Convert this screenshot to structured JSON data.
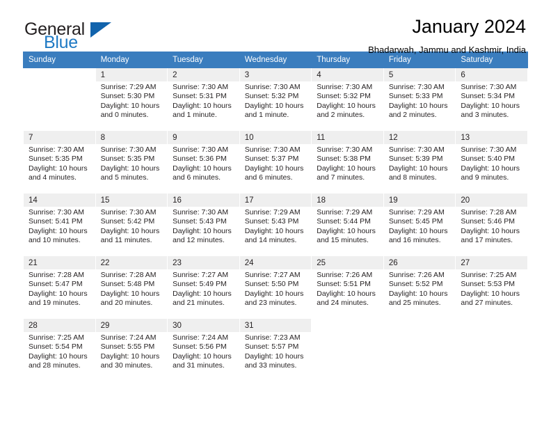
{
  "brand": {
    "word_one": "General",
    "word_two": "Blue",
    "triangle_icon": "triangle-logo-icon",
    "accent_color": "#1163ac",
    "blue_text_color": "#1f7ac4"
  },
  "header": {
    "title": "January 2024",
    "subtitle": "Bhadarwah, Jammu and Kashmir, India"
  },
  "colors": {
    "header_row_bg": "#3a7dbe",
    "header_row_text": "#ffffff",
    "daynum_bg": "#efefef",
    "body_text": "#231f20"
  },
  "weekday_headers": [
    "Sunday",
    "Monday",
    "Tuesday",
    "Wednesday",
    "Thursday",
    "Friday",
    "Saturday"
  ],
  "weeks": [
    [
      {
        "day": "",
        "lines": []
      },
      {
        "day": "1",
        "lines": [
          "Sunrise: 7:29 AM",
          "Sunset: 5:30 PM",
          "Daylight: 10 hours",
          "and 0 minutes."
        ]
      },
      {
        "day": "2",
        "lines": [
          "Sunrise: 7:30 AM",
          "Sunset: 5:31 PM",
          "Daylight: 10 hours",
          "and 1 minute."
        ]
      },
      {
        "day": "3",
        "lines": [
          "Sunrise: 7:30 AM",
          "Sunset: 5:32 PM",
          "Daylight: 10 hours",
          "and 1 minute."
        ]
      },
      {
        "day": "4",
        "lines": [
          "Sunrise: 7:30 AM",
          "Sunset: 5:32 PM",
          "Daylight: 10 hours",
          "and 2 minutes."
        ]
      },
      {
        "day": "5",
        "lines": [
          "Sunrise: 7:30 AM",
          "Sunset: 5:33 PM",
          "Daylight: 10 hours",
          "and 2 minutes."
        ]
      },
      {
        "day": "6",
        "lines": [
          "Sunrise: 7:30 AM",
          "Sunset: 5:34 PM",
          "Daylight: 10 hours",
          "and 3 minutes."
        ]
      }
    ],
    [
      {
        "day": "7",
        "lines": [
          "Sunrise: 7:30 AM",
          "Sunset: 5:35 PM",
          "Daylight: 10 hours",
          "and 4 minutes."
        ]
      },
      {
        "day": "8",
        "lines": [
          "Sunrise: 7:30 AM",
          "Sunset: 5:35 PM",
          "Daylight: 10 hours",
          "and 5 minutes."
        ]
      },
      {
        "day": "9",
        "lines": [
          "Sunrise: 7:30 AM",
          "Sunset: 5:36 PM",
          "Daylight: 10 hours",
          "and 6 minutes."
        ]
      },
      {
        "day": "10",
        "lines": [
          "Sunrise: 7:30 AM",
          "Sunset: 5:37 PM",
          "Daylight: 10 hours",
          "and 6 minutes."
        ]
      },
      {
        "day": "11",
        "lines": [
          "Sunrise: 7:30 AM",
          "Sunset: 5:38 PM",
          "Daylight: 10 hours",
          "and 7 minutes."
        ]
      },
      {
        "day": "12",
        "lines": [
          "Sunrise: 7:30 AM",
          "Sunset: 5:39 PM",
          "Daylight: 10 hours",
          "and 8 minutes."
        ]
      },
      {
        "day": "13",
        "lines": [
          "Sunrise: 7:30 AM",
          "Sunset: 5:40 PM",
          "Daylight: 10 hours",
          "and 9 minutes."
        ]
      }
    ],
    [
      {
        "day": "14",
        "lines": [
          "Sunrise: 7:30 AM",
          "Sunset: 5:41 PM",
          "Daylight: 10 hours",
          "and 10 minutes."
        ]
      },
      {
        "day": "15",
        "lines": [
          "Sunrise: 7:30 AM",
          "Sunset: 5:42 PM",
          "Daylight: 10 hours",
          "and 11 minutes."
        ]
      },
      {
        "day": "16",
        "lines": [
          "Sunrise: 7:30 AM",
          "Sunset: 5:43 PM",
          "Daylight: 10 hours",
          "and 12 minutes."
        ]
      },
      {
        "day": "17",
        "lines": [
          "Sunrise: 7:29 AM",
          "Sunset: 5:43 PM",
          "Daylight: 10 hours",
          "and 14 minutes."
        ]
      },
      {
        "day": "18",
        "lines": [
          "Sunrise: 7:29 AM",
          "Sunset: 5:44 PM",
          "Daylight: 10 hours",
          "and 15 minutes."
        ]
      },
      {
        "day": "19",
        "lines": [
          "Sunrise: 7:29 AM",
          "Sunset: 5:45 PM",
          "Daylight: 10 hours",
          "and 16 minutes."
        ]
      },
      {
        "day": "20",
        "lines": [
          "Sunrise: 7:28 AM",
          "Sunset: 5:46 PM",
          "Daylight: 10 hours",
          "and 17 minutes."
        ]
      }
    ],
    [
      {
        "day": "21",
        "lines": [
          "Sunrise: 7:28 AM",
          "Sunset: 5:47 PM",
          "Daylight: 10 hours",
          "and 19 minutes."
        ]
      },
      {
        "day": "22",
        "lines": [
          "Sunrise: 7:28 AM",
          "Sunset: 5:48 PM",
          "Daylight: 10 hours",
          "and 20 minutes."
        ]
      },
      {
        "day": "23",
        "lines": [
          "Sunrise: 7:27 AM",
          "Sunset: 5:49 PM",
          "Daylight: 10 hours",
          "and 21 minutes."
        ]
      },
      {
        "day": "24",
        "lines": [
          "Sunrise: 7:27 AM",
          "Sunset: 5:50 PM",
          "Daylight: 10 hours",
          "and 23 minutes."
        ]
      },
      {
        "day": "25",
        "lines": [
          "Sunrise: 7:26 AM",
          "Sunset: 5:51 PM",
          "Daylight: 10 hours",
          "and 24 minutes."
        ]
      },
      {
        "day": "26",
        "lines": [
          "Sunrise: 7:26 AM",
          "Sunset: 5:52 PM",
          "Daylight: 10 hours",
          "and 25 minutes."
        ]
      },
      {
        "day": "27",
        "lines": [
          "Sunrise: 7:25 AM",
          "Sunset: 5:53 PM",
          "Daylight: 10 hours",
          "and 27 minutes."
        ]
      }
    ],
    [
      {
        "day": "28",
        "lines": [
          "Sunrise: 7:25 AM",
          "Sunset: 5:54 PM",
          "Daylight: 10 hours",
          "and 28 minutes."
        ]
      },
      {
        "day": "29",
        "lines": [
          "Sunrise: 7:24 AM",
          "Sunset: 5:55 PM",
          "Daylight: 10 hours",
          "and 30 minutes."
        ]
      },
      {
        "day": "30",
        "lines": [
          "Sunrise: 7:24 AM",
          "Sunset: 5:56 PM",
          "Daylight: 10 hours",
          "and 31 minutes."
        ]
      },
      {
        "day": "31",
        "lines": [
          "Sunrise: 7:23 AM",
          "Sunset: 5:57 PM",
          "Daylight: 10 hours",
          "and 33 minutes."
        ]
      },
      {
        "day": "",
        "lines": []
      },
      {
        "day": "",
        "lines": []
      },
      {
        "day": "",
        "lines": []
      }
    ]
  ]
}
